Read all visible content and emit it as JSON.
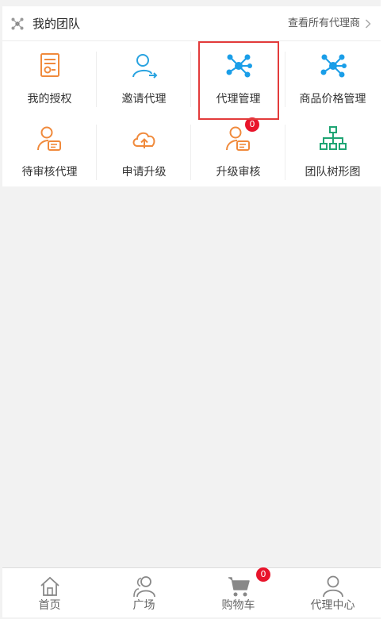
{
  "header": {
    "title": "我的团队",
    "view_all": "查看所有代理商",
    "icon": "team-icon"
  },
  "grid": [
    {
      "label": "我的授权",
      "icon": "certificate-icon",
      "color": "#f08a3c"
    },
    {
      "label": "邀请代理",
      "icon": "invite-user-icon",
      "color": "#29a3e0"
    },
    {
      "label": "代理管理",
      "icon": "network-icon",
      "color": "#1a9ee8"
    },
    {
      "label": "商品价格管理",
      "icon": "network-icon",
      "color": "#1a9ee8"
    },
    {
      "label": "待审核代理",
      "icon": "user-card-icon",
      "color": "#f08a3c"
    },
    {
      "label": "申请升级",
      "icon": "cloud-upload-icon",
      "color": "#f08a3c"
    },
    {
      "label": "升级审核",
      "icon": "user-card-icon",
      "color": "#f08a3c",
      "badge": "0"
    },
    {
      "label": "团队树形图",
      "icon": "org-chart-icon",
      "color": "#1fa574"
    }
  ],
  "tabbar": [
    {
      "label": "首页",
      "icon": "home-icon"
    },
    {
      "label": "广场",
      "icon": "users-icon"
    },
    {
      "label": "购物车",
      "icon": "cart-icon",
      "badge": "0"
    },
    {
      "label": "代理中心",
      "icon": "user-icon"
    }
  ],
  "colors": {
    "accent_orange": "#f08a3c",
    "accent_blue": "#1a9ee8",
    "accent_green": "#1fa574",
    "badge_red": "#e8142b",
    "highlight_red": "#e33b3b"
  }
}
